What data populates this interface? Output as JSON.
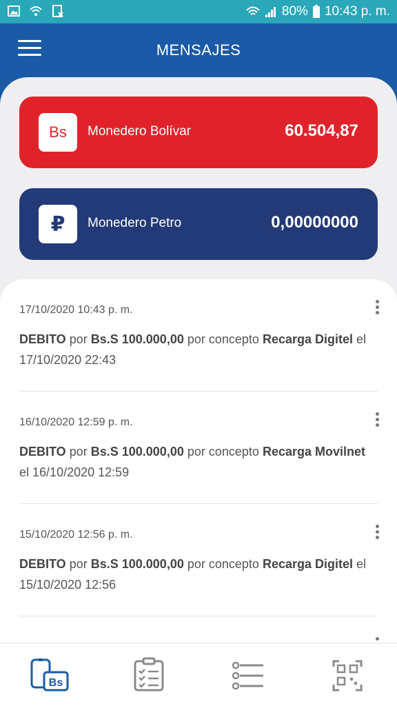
{
  "status_bar": {
    "battery": "80%",
    "time": "10:43 p. m.",
    "icons": [
      "image-icon",
      "wifi-icon",
      "clipboard-x-icon",
      "wifi-signal-icon",
      "cellular-signal-icon",
      "battery-icon"
    ]
  },
  "header": {
    "title": "MENSAJES",
    "menu_icon": "hamburger-menu-icon"
  },
  "wallets": [
    {
      "logo_text": "Bs",
      "label": "Monedero Bolívar",
      "amount": "60.504,87",
      "color": "#e0232a"
    },
    {
      "logo_symbol": "₽",
      "label": "Monedero Petro",
      "amount": "0,00000000",
      "color": "#233a78"
    }
  ],
  "messages": [
    {
      "date": "17/10/2020 10:43 p. m.",
      "type": "DEBITO",
      "w_por": "por",
      "amount": "Bs.S 100.000,00",
      "w_concepto": "por concepto",
      "concept": "Recarga Digitel",
      "w_el": "el",
      "datetime": "17/10/2020 22:43"
    },
    {
      "date": "16/10/2020 12:59 p. m.",
      "type": "DEBITO",
      "w_por": "por",
      "amount": "Bs.S 100.000,00",
      "w_concepto": "por concepto",
      "concept": "Recarga Movilnet",
      "w_el": "el",
      "datetime": "16/10/2020 12:59"
    },
    {
      "date": "15/10/2020 12:56 p. m.",
      "type": "DEBITO",
      "w_por": "por",
      "amount": "Bs.S 100.000,00",
      "w_concepto": "por concepto",
      "concept": "Recarga Digitel",
      "w_el": "el",
      "datetime": "15/10/2020 12:56"
    }
  ],
  "bottom_nav": {
    "items": [
      {
        "icon": "wallet-bs-icon",
        "label": "Bs",
        "active": true
      },
      {
        "icon": "checklist-icon",
        "active": false
      },
      {
        "icon": "list-icon",
        "active": false
      },
      {
        "icon": "qr-code-icon",
        "active": false
      }
    ],
    "active_color": "#1a5aa6",
    "inactive_color": "#8a8a8a"
  }
}
